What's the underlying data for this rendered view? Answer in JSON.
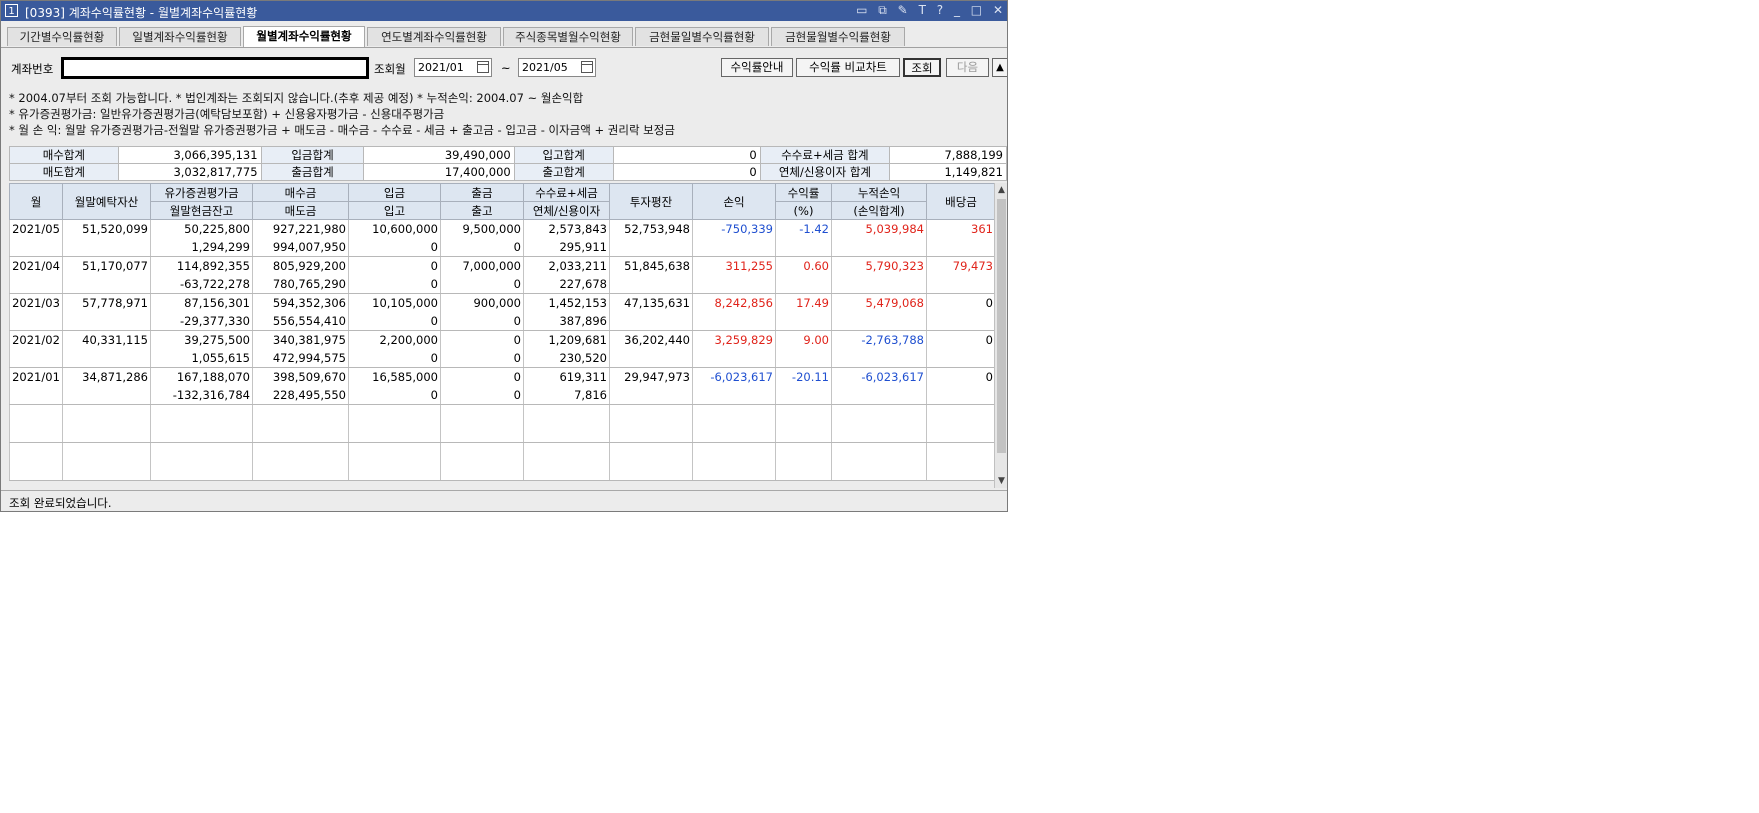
{
  "window": {
    "number": "1",
    "title": "[0393] 계좌수익률현황 - 월별계좌수익률현황",
    "tools": [
      "▭",
      "⧉",
      "✎",
      "T",
      "?",
      "_",
      "□",
      "✕"
    ]
  },
  "tabs": [
    {
      "label": "기간별수익률현황",
      "active": false
    },
    {
      "label": "일별계좌수익률현황",
      "active": false
    },
    {
      "label": "월별계좌수익률현황",
      "active": true
    },
    {
      "label": "연도별계좌수익률현황",
      "active": false
    },
    {
      "label": "주식종목별월수익현황",
      "active": false
    },
    {
      "label": "금현물일별수익률현황",
      "active": false
    },
    {
      "label": "금현물월별수익률현황",
      "active": false
    }
  ],
  "query": {
    "account_label": "계좌번호",
    "account_value": "",
    "month_label": "조회월",
    "from": "2021/01",
    "tilde": "~",
    "to": "2021/05",
    "buttons": {
      "guide": "수익률안내",
      "chart": "수익률 비교차트",
      "search": "조회",
      "next": "다음",
      "more": "▲"
    }
  },
  "notes": [
    "* 2004.07부터 조회 가능합니다.   * 법인계좌는 조회되지 않습니다.(추후 제공 예정)   * 누적손익: 2004.07 ~ 월손익합",
    "* 유가증권평가금: 일반유가증권평가금(예탁담보포함) + 신용융자평가금 - 신용대주평가금",
    "* 월 손 익: 월말 유가증권평가금-전월말 유가증권평가금 + 매도금 - 매수금 - 수수료 - 세금 + 출고금 - 입고금 - 이자금액 + 권리락 보정금"
  ],
  "summary": [
    [
      {
        "label": "매수합계",
        "value": "3,066,395,131"
      },
      {
        "label": "입금합계",
        "value": "39,490,000"
      },
      {
        "label": "입고합계",
        "value": "0"
      },
      {
        "label": "수수료+세금 합계",
        "value": "7,888,199"
      }
    ],
    [
      {
        "label": "매도합계",
        "value": "3,032,817,775"
      },
      {
        "label": "출금합계",
        "value": "17,400,000"
      },
      {
        "label": "출고합계",
        "value": "0"
      },
      {
        "label": "연체/신용이자 합계",
        "value": "1,149,821"
      }
    ]
  ],
  "grid": {
    "headers": {
      "month": "월",
      "deposit": "월말예탁자산",
      "eval_top": "유가증권평가금",
      "eval_bottom": "월말현금잔고",
      "buy_top": "매수금",
      "buy_bottom": "매도금",
      "in_top": "입금",
      "in_bottom": "입고",
      "out_top": "출금",
      "out_bottom": "출고",
      "fee_top": "수수료+세금",
      "fee_bottom": "연체/신용이자",
      "avg": "투자평잔",
      "pnl": "손익",
      "rate_top": "수익률",
      "rate_bottom": "(%)",
      "cum_top": "누적손익",
      "cum_bottom": "(손익합계)",
      "div": "배당금"
    },
    "rows": [
      {
        "month": "2021/05",
        "deposit": "51,520,099",
        "eval": "50,225,800",
        "cash": "1,294,299",
        "buy": "927,221,980",
        "sell": "994,007,950",
        "dep_in": "10,600,000",
        "stock_in": "0",
        "dep_out": "9,500,000",
        "stock_out": "0",
        "fee": "2,573,843",
        "interest": "295,911",
        "avg": "52,753,948",
        "pnl": "-750,339",
        "rate": "-1.42",
        "cum": "5,039,984",
        "div": "361"
      },
      {
        "month": "2021/04",
        "deposit": "51,170,077",
        "eval": "114,892,355",
        "cash": "-63,722,278",
        "buy": "805,929,200",
        "sell": "780,765,290",
        "dep_in": "0",
        "stock_in": "0",
        "dep_out": "7,000,000",
        "stock_out": "0",
        "fee": "2,033,211",
        "interest": "227,678",
        "avg": "51,845,638",
        "pnl": "311,255",
        "rate": "0.60",
        "cum": "5,790,323",
        "div": "79,473"
      },
      {
        "month": "2021/03",
        "deposit": "57,778,971",
        "eval": "87,156,301",
        "cash": "-29,377,330",
        "buy": "594,352,306",
        "sell": "556,554,410",
        "dep_in": "10,105,000",
        "stock_in": "0",
        "dep_out": "900,000",
        "stock_out": "0",
        "fee": "1,452,153",
        "interest": "387,896",
        "avg": "47,135,631",
        "pnl": "8,242,856",
        "rate": "17.49",
        "cum": "5,479,068",
        "div": "0"
      },
      {
        "month": "2021/02",
        "deposit": "40,331,115",
        "eval": "39,275,500",
        "cash": "1,055,615",
        "buy": "340,381,975",
        "sell": "472,994,575",
        "dep_in": "2,200,000",
        "stock_in": "0",
        "dep_out": "0",
        "stock_out": "0",
        "fee": "1,209,681",
        "interest": "230,520",
        "avg": "36,202,440",
        "pnl": "3,259,829",
        "rate": "9.00",
        "cum": "-2,763,788",
        "div": "0"
      },
      {
        "month": "2021/01",
        "deposit": "34,871,286",
        "eval": "167,188,070",
        "cash": "-132,316,784",
        "buy": "398,509,670",
        "sell": "228,495,550",
        "dep_in": "16,585,000",
        "stock_in": "0",
        "dep_out": "0",
        "stock_out": "0",
        "fee": "619,311",
        "interest": "7,816",
        "avg": "29,947,973",
        "pnl": "-6,023,617",
        "rate": "-20.11",
        "cum": "-6,023,617",
        "div": "0"
      }
    ]
  },
  "status": "조회 완료되었습니다.",
  "colors": {
    "titlebar": "#3a5a9c",
    "header_bg": "#dde6f1",
    "negative": "#1f4fd0",
    "positive": "#e0231a"
  }
}
